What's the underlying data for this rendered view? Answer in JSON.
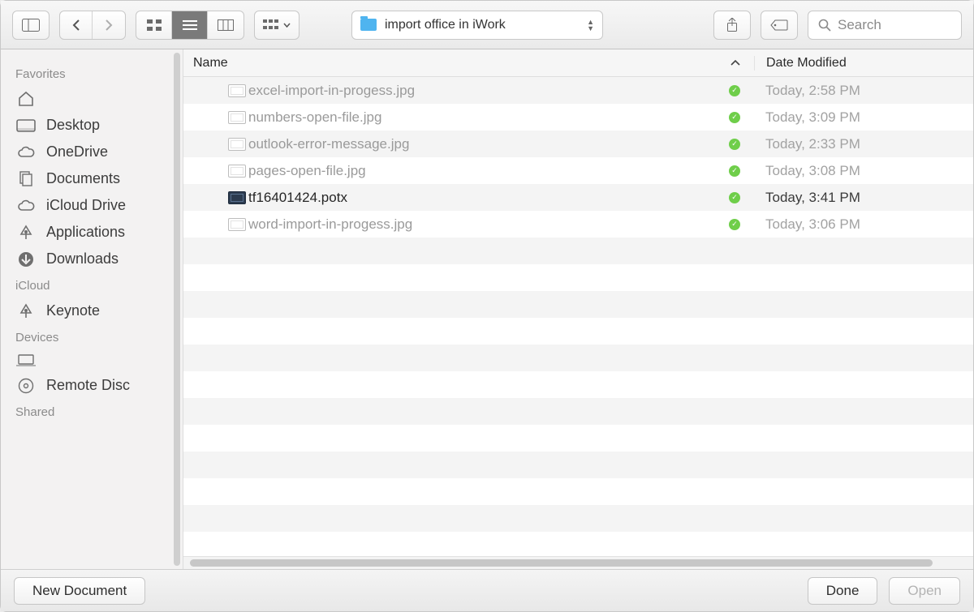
{
  "toolbar": {
    "path_label": "import office in iWork",
    "search_placeholder": "Search"
  },
  "sidebar": {
    "sections": [
      {
        "title": "Favorites",
        "items": [
          {
            "icon": "home",
            "label": ""
          },
          {
            "icon": "desktop",
            "label": "Desktop"
          },
          {
            "icon": "cloud",
            "label": "OneDrive"
          },
          {
            "icon": "documents",
            "label": "Documents"
          },
          {
            "icon": "cloud",
            "label": "iCloud Drive"
          },
          {
            "icon": "apps",
            "label": "Applications"
          },
          {
            "icon": "download",
            "label": "Downloads"
          }
        ]
      },
      {
        "title": "iCloud",
        "items": [
          {
            "icon": "apps",
            "label": "Keynote"
          }
        ]
      },
      {
        "title": "Devices",
        "items": [
          {
            "icon": "laptop",
            "label": ""
          },
          {
            "icon": "disc",
            "label": "Remote Disc"
          }
        ]
      },
      {
        "title": "Shared",
        "items": []
      }
    ]
  },
  "columns": {
    "name": "Name",
    "date": "Date Modified"
  },
  "files": [
    {
      "name": "excel-import-in-progess.jpg",
      "date": "Today, 2:58 PM",
      "enabled": false,
      "type": "img"
    },
    {
      "name": "numbers-open-file.jpg",
      "date": "Today, 3:09 PM",
      "enabled": false,
      "type": "img"
    },
    {
      "name": "outlook-error-message.jpg",
      "date": "Today, 2:33 PM",
      "enabled": false,
      "type": "img"
    },
    {
      "name": "pages-open-file.jpg",
      "date": "Today, 3:08 PM",
      "enabled": false,
      "type": "img"
    },
    {
      "name": "tf16401424.potx",
      "date": "Today, 3:41 PM",
      "enabled": true,
      "type": "potx"
    },
    {
      "name": "word-import-in-progess.jpg",
      "date": "Today, 3:06 PM",
      "enabled": false,
      "type": "img"
    }
  ],
  "footer": {
    "new_document": "New Document",
    "done": "Done",
    "open": "Open"
  }
}
